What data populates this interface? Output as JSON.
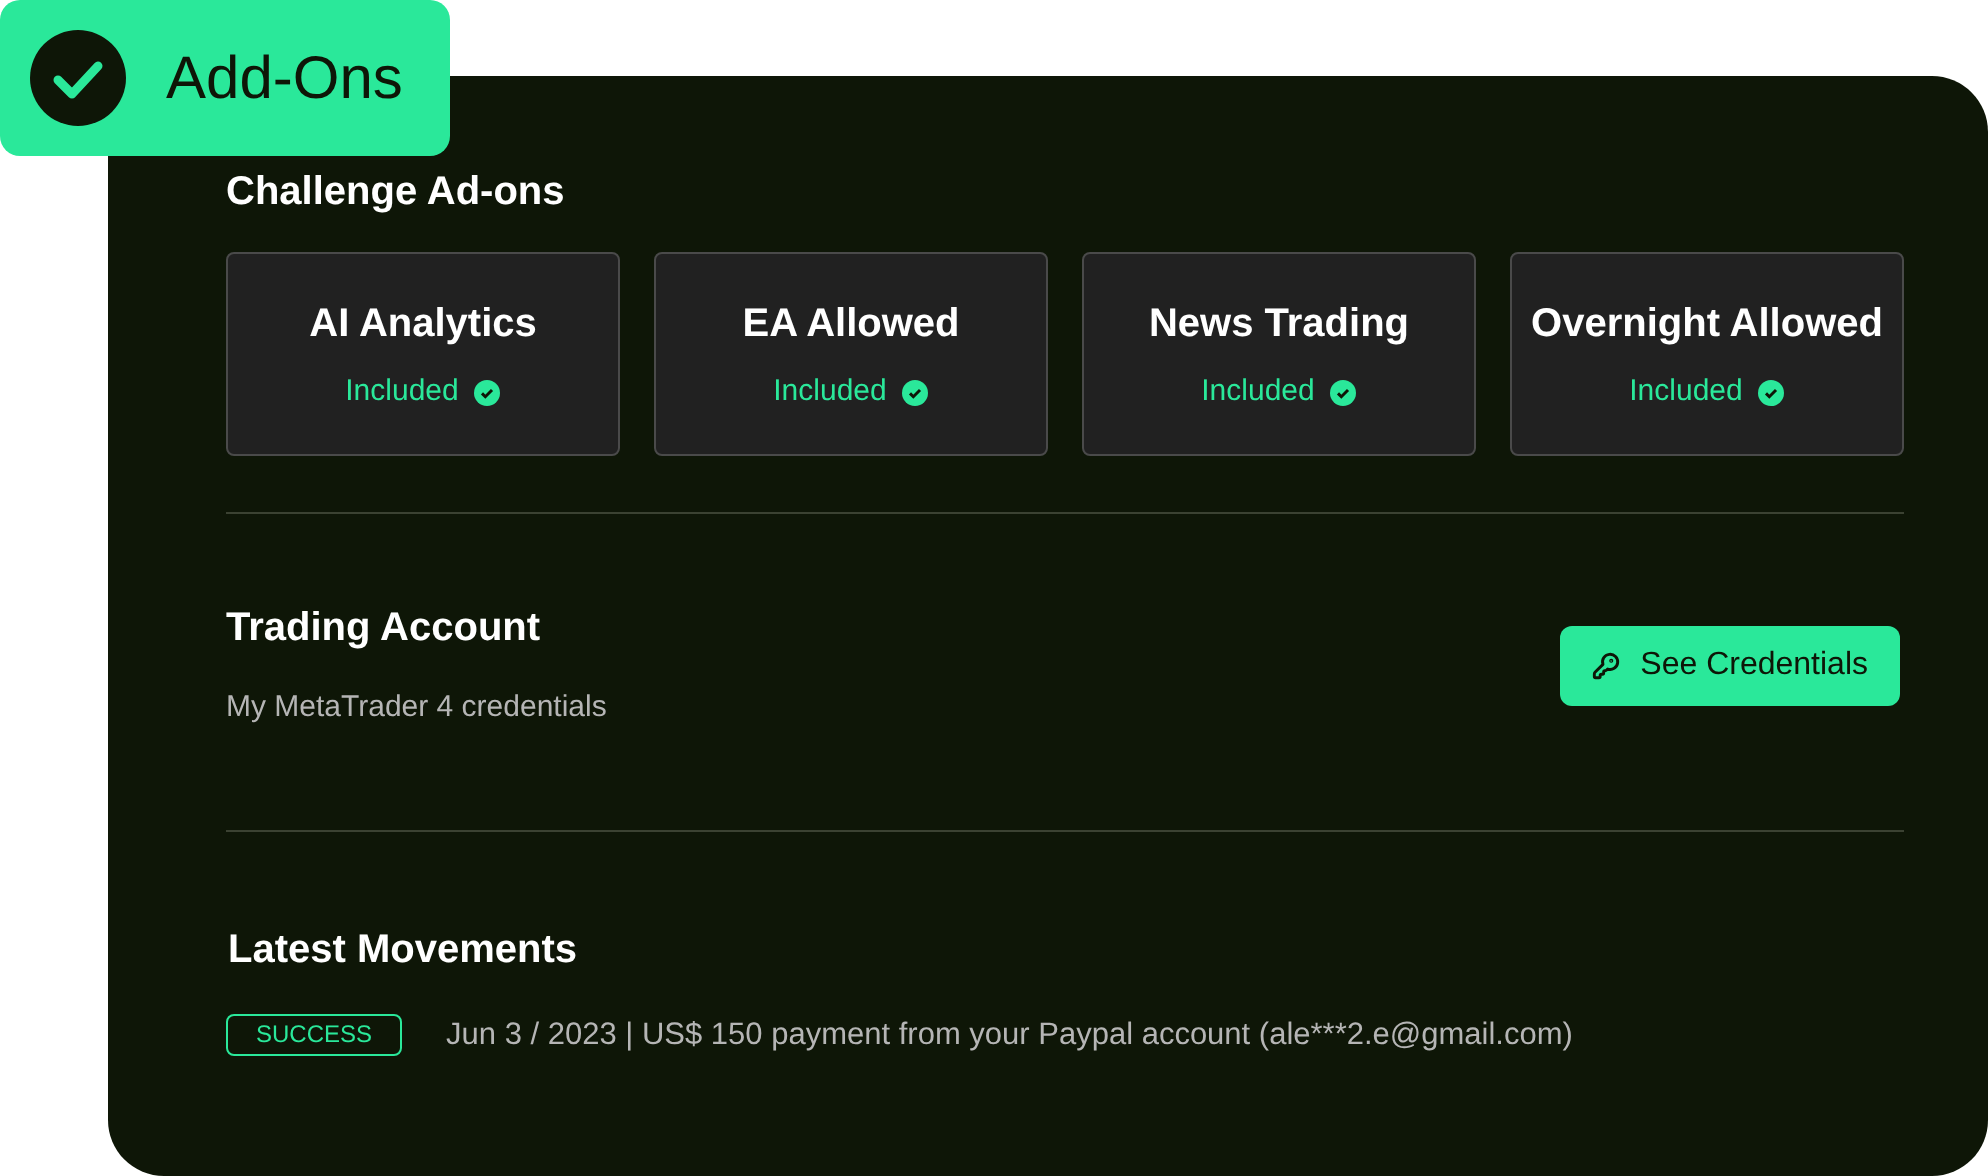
{
  "header_badge": {
    "label": "Add-Ons",
    "checked": true
  },
  "addons": {
    "title": "Challenge Ad-ons",
    "items": [
      {
        "name": "AI Analytics",
        "status": "Included",
        "included": true
      },
      {
        "name": "EA Allowed",
        "status": "Included",
        "included": true
      },
      {
        "name": "News Trading",
        "status": "Included",
        "included": true
      },
      {
        "name": "Overnight Allowed",
        "status": "Included",
        "included": true
      }
    ]
  },
  "trading_account": {
    "title": "Trading Account",
    "subtitle": "My MetaTrader 4 credentials",
    "button": "See Credentials"
  },
  "movements": {
    "title": "Latest Movements",
    "items": [
      {
        "status": "SUCCESS",
        "color": "#2ae89a",
        "text": "Jun 3 / 2023 | US$ 150 payment from your Paypal account (ale***2.e@gmail.com)"
      }
    ]
  }
}
